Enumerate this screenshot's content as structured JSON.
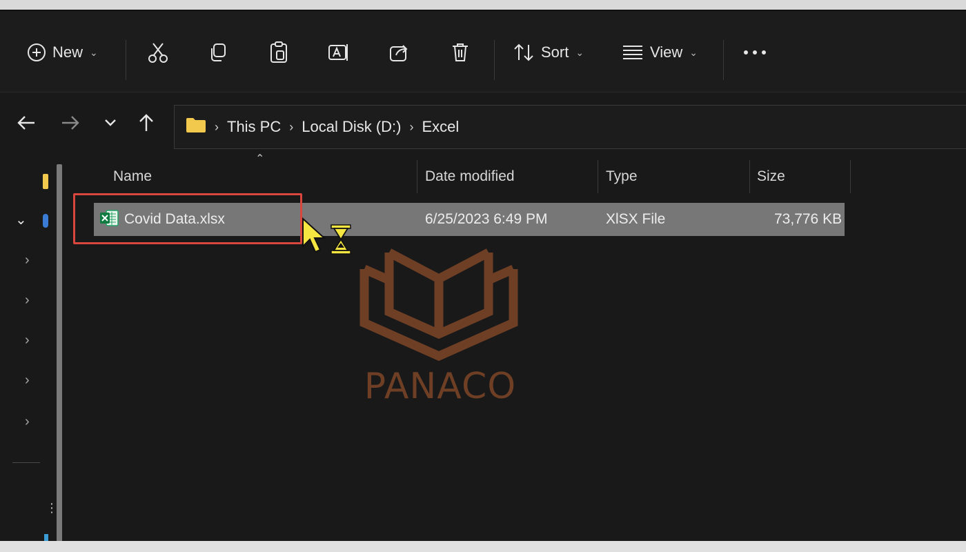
{
  "toolbar": {
    "new_label": "New",
    "sort_label": "Sort",
    "view_label": "View",
    "icons": [
      "plus-circle-icon",
      "cut-icon",
      "copy-icon",
      "paste-icon",
      "rename-icon",
      "share-icon",
      "delete-icon",
      "sort-icon",
      "view-icon",
      "more-icon"
    ]
  },
  "address": {
    "crumbs": [
      "This PC",
      "Local Disk (D:)",
      "Excel"
    ]
  },
  "columns": {
    "name": "Name",
    "date": "Date modified",
    "type": "Type",
    "size": "Size"
  },
  "files": [
    {
      "name": "Covid Data.xlsx",
      "date": "6/25/2023 6:49 PM",
      "type": "XlSX File",
      "size": "73,776 KB",
      "selected": true
    }
  ],
  "watermark": {
    "text": "PANACO"
  },
  "colors": {
    "background": "#191919",
    "selection": "#777777",
    "callout": "#d9463d",
    "folder": "#f2c94c",
    "excel": "#21a366",
    "cursor": "#f5e642",
    "watermark": "#6e3f24"
  }
}
